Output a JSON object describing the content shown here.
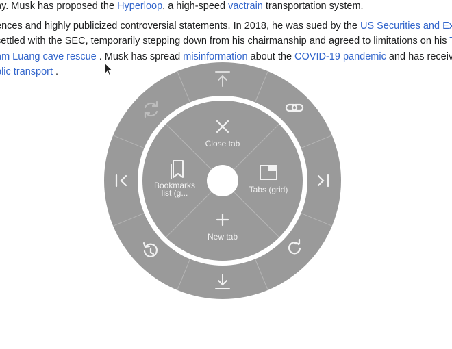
{
  "article": {
    "line1": {
      "t1": "ay. Musk has proposed the ",
      "l1": "Hyperloop",
      "t2": ", a high-speed ",
      "l2": "vactrain",
      "t3": " transportation system."
    },
    "line2": {
      "t1": "ences and highly publicized controversial statements. In 2018, he was sued by the ",
      "l1": "US Securities and Exch"
    },
    "line3": {
      "t1": "settled with the SEC, temporarily stepping down from his chairmanship and agreed to limitations on his ",
      "l1": "Tw"
    },
    "line4": {
      "l1": "am Luang cave rescue ",
      "t1": ". Musk has spread ",
      "l2": "misinformation",
      "t2": " about the ",
      "l3": "COVID-19 pandemic",
      "t3": " and has receive"
    },
    "line5": {
      "l1": "blic transport ",
      "t1": "."
    }
  },
  "pie_menu": {
    "inner": {
      "close_tab": "Close tab",
      "tabs_grid": "Tabs (grid)",
      "new_tab": "New tab",
      "bookmarks_line1": "Bookmarks",
      "bookmarks_line2": "list (g..."
    },
    "outer_icons": [
      "scroll-to-top-icon",
      "copy-link-icon",
      "last-tab-icon",
      "reload-icon",
      "scroll-to-bottom-icon",
      "history-icon",
      "first-tab-icon",
      "sync-icon"
    ]
  },
  "colors": {
    "menu_fill": "#9a9a9a",
    "menu_ring": "#ffffff",
    "icon": "#f2f2f2",
    "link": "#3366cc"
  }
}
